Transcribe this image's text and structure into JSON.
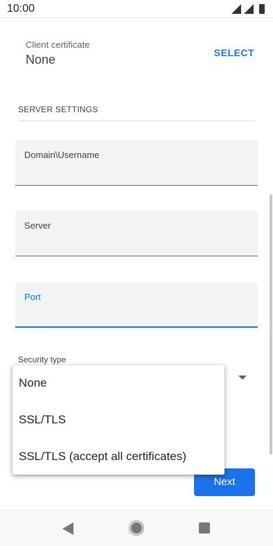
{
  "status_bar": {
    "time": "10:00",
    "icons": [
      "signal-icon",
      "signal-icon",
      "battery-icon"
    ]
  },
  "client_certificate": {
    "label": "Client certificate",
    "value": "None",
    "action": "SELECT"
  },
  "server_settings": {
    "header": "SERVER SETTINGS",
    "fields": [
      {
        "label": "Domain\\Username",
        "value": ""
      },
      {
        "label": "Server",
        "value": ""
      },
      {
        "label": "Port",
        "value": ""
      }
    ],
    "security_type_label": "Security type"
  },
  "security_popup": {
    "options": [
      "None",
      "SSL/TLS",
      "SSL/TLS (accept all certificates)"
    ]
  },
  "next_button": "Next",
  "colors": {
    "accent": "#1a73e8",
    "field_bg": "#f1f3f4"
  },
  "nav_bar": {
    "icons": [
      "back-icon",
      "home-icon",
      "recents-icon"
    ]
  }
}
